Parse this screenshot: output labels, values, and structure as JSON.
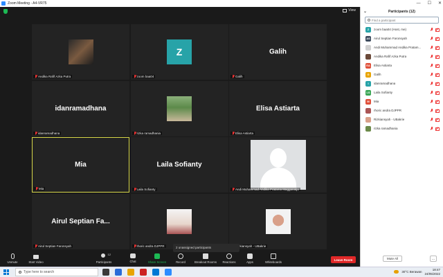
{
  "window": {
    "title": "Zoom Meeting - A4-VR75",
    "controls": [
      "—",
      "☐",
      "✕"
    ]
  },
  "meeting": {
    "view_label": "View",
    "tiles": [
      {
        "name": "Andika Rafif Azka Putra",
        "display": "photo",
        "big": ""
      },
      {
        "name": "zoom baa04",
        "display": "z-avatar",
        "big": "Z"
      },
      {
        "name": "Galih",
        "display": "text",
        "big": "Galih"
      },
      {
        "name": "idanramadhana",
        "display": "text",
        "big": "idanramadhana"
      },
      {
        "name": "rizka ramadhania",
        "display": "photo-trees",
        "big": ""
      },
      {
        "name": "Elisa Astiarta",
        "display": "text",
        "big": "Elisa Astiarta"
      },
      {
        "name": "Mia",
        "display": "text",
        "big": "Mia",
        "active": true
      },
      {
        "name": "Laila Sofianty",
        "display": "text",
        "big": "Laila Sofianty"
      },
      {
        "name": "Andi Muhammad Andika Pratama Magganatja",
        "display": "placeholder",
        "big": ""
      },
      {
        "name": "Airul Septian Faronsyah",
        "display": "text",
        "big": "Airul Septian Fa..."
      },
      {
        "name": "rhoric andra DJPPR",
        "display": "photo-gym",
        "big": ""
      },
      {
        "name": "Rizkiansyah - UBakrie",
        "display": "photo-face",
        "big": ""
      }
    ],
    "unassigned_label": "2 unassigned participants"
  },
  "toolbar": {
    "unmute": "Unmute",
    "start_video": "Start Video",
    "participants": "Participants",
    "participants_count": "12",
    "chat": "Chat",
    "share_screen": "Share Screen",
    "record": "Record",
    "breakout_rooms": "Breakout Rooms",
    "reactions": "Reactions",
    "apps": "Apps",
    "whiteboards": "Whiteboards",
    "leave": "Leave Room"
  },
  "participants_panel": {
    "title": "Participants (12)",
    "search_placeholder": "Find a participant",
    "items": [
      {
        "name": "zoom baa04 (Host, me)",
        "initials": "Z",
        "color": "#27a3a8"
      },
      {
        "name": "Airul Septian Faronsyah",
        "initials": "AS",
        "color": "#3c4a5c"
      },
      {
        "name": "Andi Muhammad Andika Pratam...",
        "initials": "",
        "color": "#d0d0d0"
      },
      {
        "name": "Andika Rafif Azka Putra",
        "initials": "",
        "color": "#6b4a3a"
      },
      {
        "name": "Elisa Astiarta",
        "initials": "EA",
        "color": "#e0503a"
      },
      {
        "name": "Galih",
        "initials": "G",
        "color": "#e8a400"
      },
      {
        "name": "idanramadhana",
        "initials": "I",
        "color": "#27a3a8"
      },
      {
        "name": "Laila Sofianty",
        "initials": "LS",
        "color": "#3aa655"
      },
      {
        "name": "Mia",
        "initials": "M",
        "color": "#e0503a"
      },
      {
        "name": "rhoric andra DJPPR",
        "initials": "",
        "color": "#a55"
      },
      {
        "name": "Rizkiansyah - UBakrie",
        "initials": "",
        "color": "#d9a089"
      },
      {
        "name": "rizka ramadhania",
        "initials": "",
        "color": "#6c8a4a"
      }
    ],
    "mute_all": "Mute All",
    "more": "..."
  },
  "taskbar": {
    "search_placeholder": "Type here to search",
    "weather": "30°C  Berawan",
    "time": "18:47",
    "date": "24/05/2022",
    "app_colors": [
      "#3a3a3a",
      "#2b6cd8",
      "#e8a400",
      "#c22",
      "#0078d4",
      "#2d8cff"
    ]
  }
}
